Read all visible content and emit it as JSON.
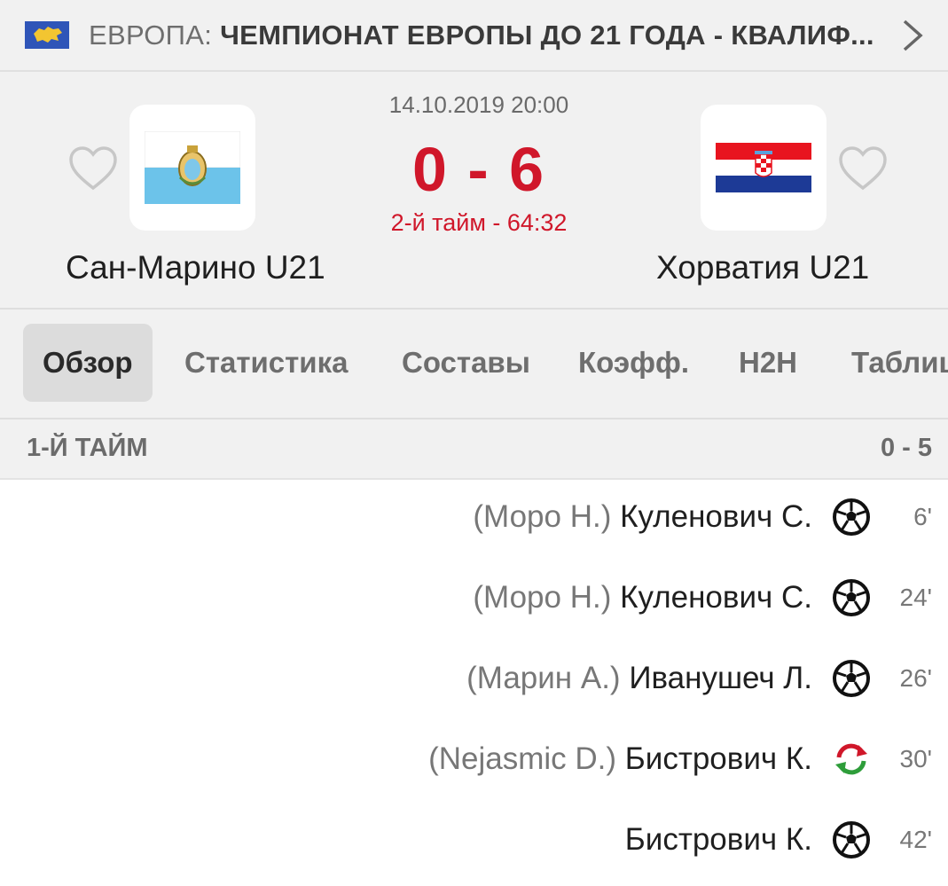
{
  "league": {
    "country": "ЕВРОПА:",
    "competition": "ЧЕМПИОНАТ ЕВРОПЫ ДО 21 ГОДА - КВАЛИФ..."
  },
  "match": {
    "datetime": "14.10.2019 20:00",
    "score": "0 - 6",
    "status": "2-й тайм - 64:32",
    "home": {
      "name": "Сан-Марино U21"
    },
    "away": {
      "name": "Хорватия U21"
    }
  },
  "tabs": [
    {
      "label": "Обзор",
      "active": true
    },
    {
      "label": "Статистика"
    },
    {
      "label": "Составы"
    },
    {
      "label": "Коэфф."
    },
    {
      "label": "H2H"
    },
    {
      "label": "Таблица"
    }
  ],
  "section": {
    "label": "1-Й ТАЙМ",
    "score": "0 - 5"
  },
  "events": [
    {
      "assist": "(Моро Н.)",
      "player": "Куленович С.",
      "icon": "goal-icon",
      "minute": "6'"
    },
    {
      "assist": "(Моро Н.)",
      "player": "Куленович С.",
      "icon": "goal-icon",
      "minute": "24'"
    },
    {
      "assist": "(Марин А.)",
      "player": "Иванушеч Л.",
      "icon": "goal-icon",
      "minute": "26'"
    },
    {
      "assist": "(Nejasmic D.)",
      "player": "Бистрович К.",
      "icon": "substitution-icon",
      "minute": "30'"
    },
    {
      "assist": "",
      "player": "Бистрович К.",
      "icon": "goal-icon",
      "minute": "42'"
    }
  ],
  "colors": {
    "accent": "#d0172a",
    "sub_in": "#2e9d3a",
    "sub_out": "#d0172a"
  }
}
